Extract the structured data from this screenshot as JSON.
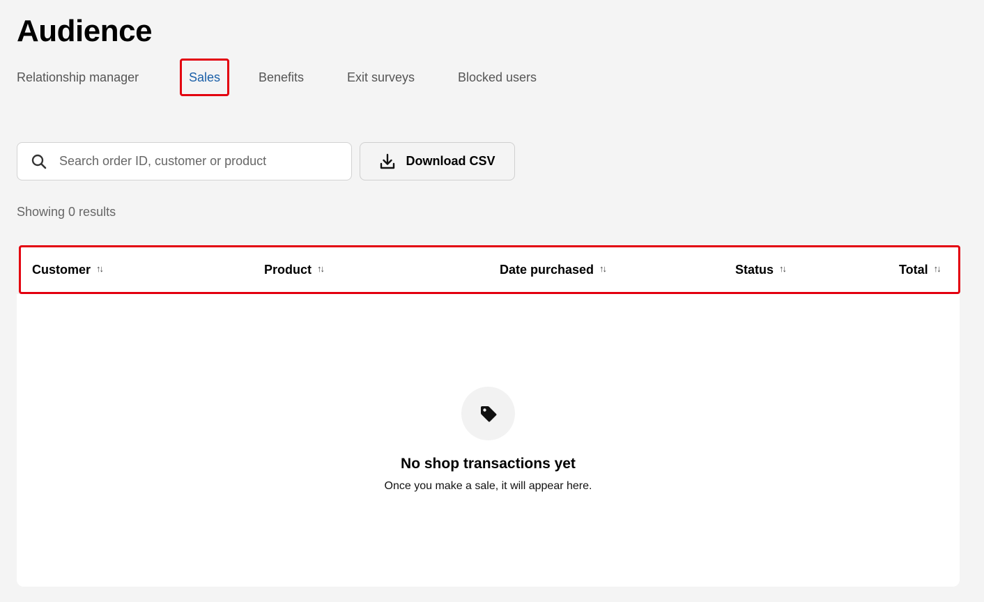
{
  "header": {
    "title": "Audience"
  },
  "tabs": [
    {
      "label": "Relationship manager",
      "active": false
    },
    {
      "label": "Sales",
      "active": true
    },
    {
      "label": "Benefits",
      "active": false
    },
    {
      "label": "Exit surveys",
      "active": false
    },
    {
      "label": "Blocked users",
      "active": false
    }
  ],
  "toolbar": {
    "search": {
      "icon": "search-icon",
      "placeholder": "Search order ID, customer or product",
      "value": ""
    },
    "download": {
      "icon": "download-icon",
      "label": "Download CSV"
    }
  },
  "results": {
    "text": "Showing 0 results"
  },
  "table": {
    "columns": [
      {
        "label": "Customer",
        "sort_icon": "sort-icon"
      },
      {
        "label": "Product",
        "sort_icon": "sort-icon"
      },
      {
        "label": "Date purchased",
        "sort_icon": "sort-icon"
      },
      {
        "label": "Status",
        "sort_icon": "sort-icon"
      },
      {
        "label": "Total",
        "sort_icon": "sort-icon"
      }
    ],
    "rows": [],
    "empty_state": {
      "icon": "tag-icon",
      "title": "No shop transactions yet",
      "subtitle": "Once you make a sale, it will appear here."
    }
  },
  "colors": {
    "background": "#f4f4f4",
    "active_tab": "#1a5fa8",
    "highlight_border": "#e3000f",
    "surface": "#ffffff"
  }
}
